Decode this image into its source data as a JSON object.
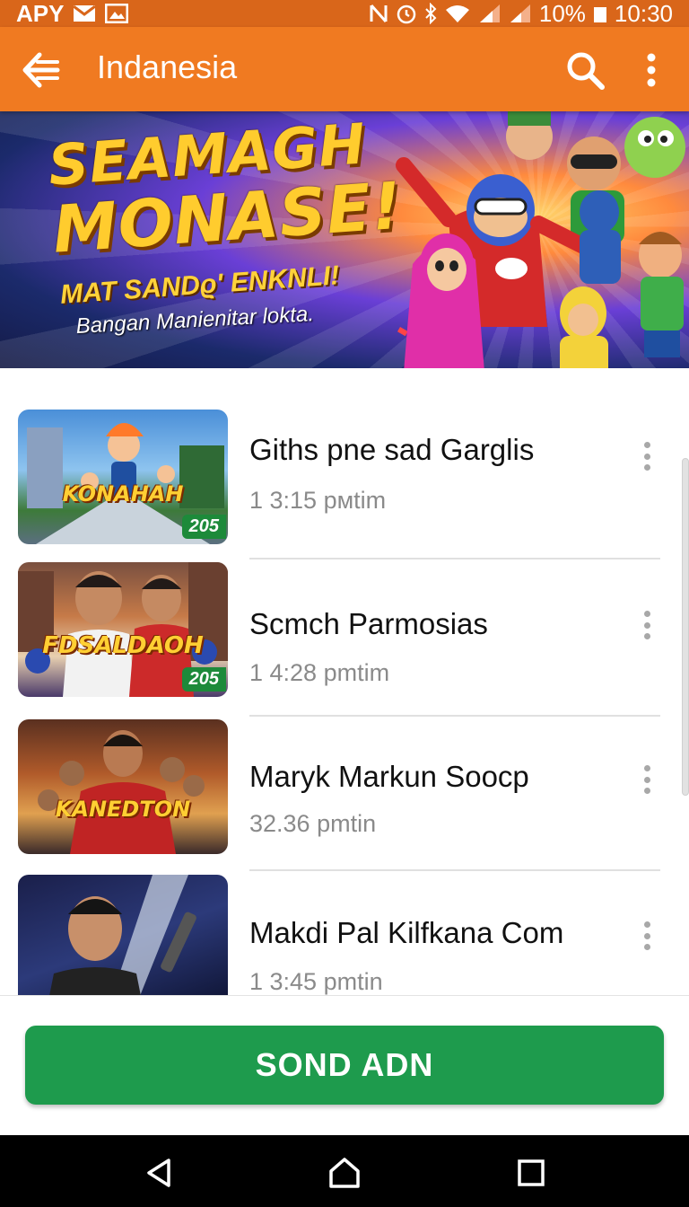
{
  "status_bar": {
    "left_text": "APY",
    "left_icons": [
      "mail-icon",
      "photo-icon"
    ],
    "right_icons": [
      "nfc-icon",
      "alarm-icon",
      "bluetooth-icon",
      "wifi-icon",
      "signal-icon",
      "signal-icon"
    ],
    "battery": "10%",
    "time": "10:30"
  },
  "app_bar": {
    "title": "Indanesia",
    "back_icon": "back-arrow-icon",
    "search_icon": "search-icon",
    "more_icon": "more-vert-icon",
    "color": "#f07a21"
  },
  "banner": {
    "headline_line1": "SEAMAGH",
    "headline_line2": "MONASE!",
    "subtitle": "MAT SANDϱ' ENKNLI!",
    "tagline": "Bangan Manienitar  lokta."
  },
  "videos": [
    {
      "title": "Giths pne sad Garglis",
      "time": "1 3:15 pмtim",
      "thumb_text": "KONAHAH",
      "badge": "205"
    },
    {
      "title": "Scmch Parmosias",
      "time": "1 4:28 pmtim",
      "thumb_text": "FDSALDAOH",
      "badge": "205"
    },
    {
      "title": "Maryk Markun Soocp",
      "time": "32.36 pmtin",
      "thumb_text": "KANEDTON",
      "badge": ""
    },
    {
      "title": "Makdi Pal Kilfkana Com",
      "time": "1 3:45 pmtin",
      "thumb_text": "",
      "badge": ""
    }
  ],
  "action_button": {
    "label": "SOND ADN",
    "color": "#1e9b4d"
  },
  "nav_bar": {
    "icons": [
      "back-triangle-icon",
      "home-icon",
      "recents-square-icon"
    ]
  }
}
